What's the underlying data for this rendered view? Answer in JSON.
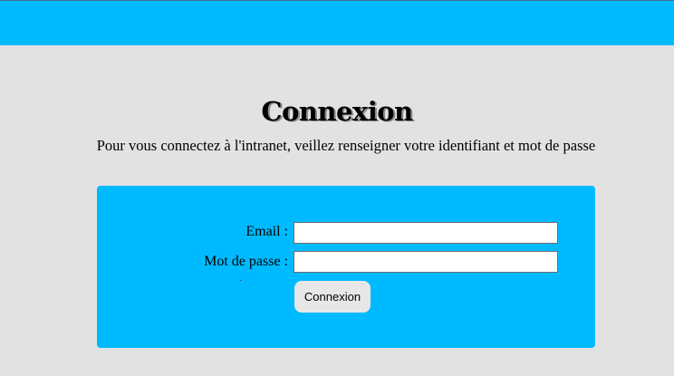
{
  "header": {
    "color": "#00baff"
  },
  "page": {
    "title": "Connexion",
    "subtitle": "Pour vous connectez à l'intranet, veillez renseigner votre identifiant et mot de passe"
  },
  "form": {
    "email_label": "Email :",
    "email_value": "",
    "password_label": "Mot de passe :",
    "password_value": "",
    "submit_label": "Connexion",
    "stray_mark": "."
  }
}
